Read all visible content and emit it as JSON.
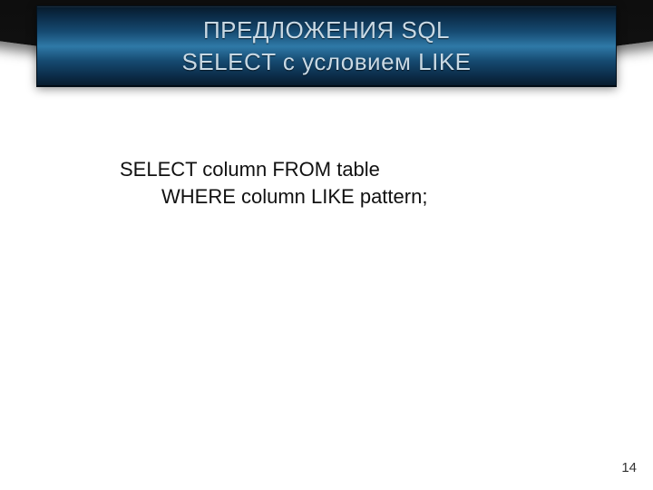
{
  "header": {
    "title_line1": "ПРЕДЛОЖЕНИЯ SQL",
    "title_line2": "SELECT с условием LIKE"
  },
  "body": {
    "sql_line1": "SELECT column FROM table",
    "sql_line2": "WHERE column LIKE pattern;"
  },
  "footer": {
    "page_number": "14"
  },
  "colors": {
    "banner_gradient_top": "#071a2b",
    "banner_gradient_mid": "#2f79a7",
    "title_text": "#c9d9e4",
    "body_text": "#111111"
  }
}
